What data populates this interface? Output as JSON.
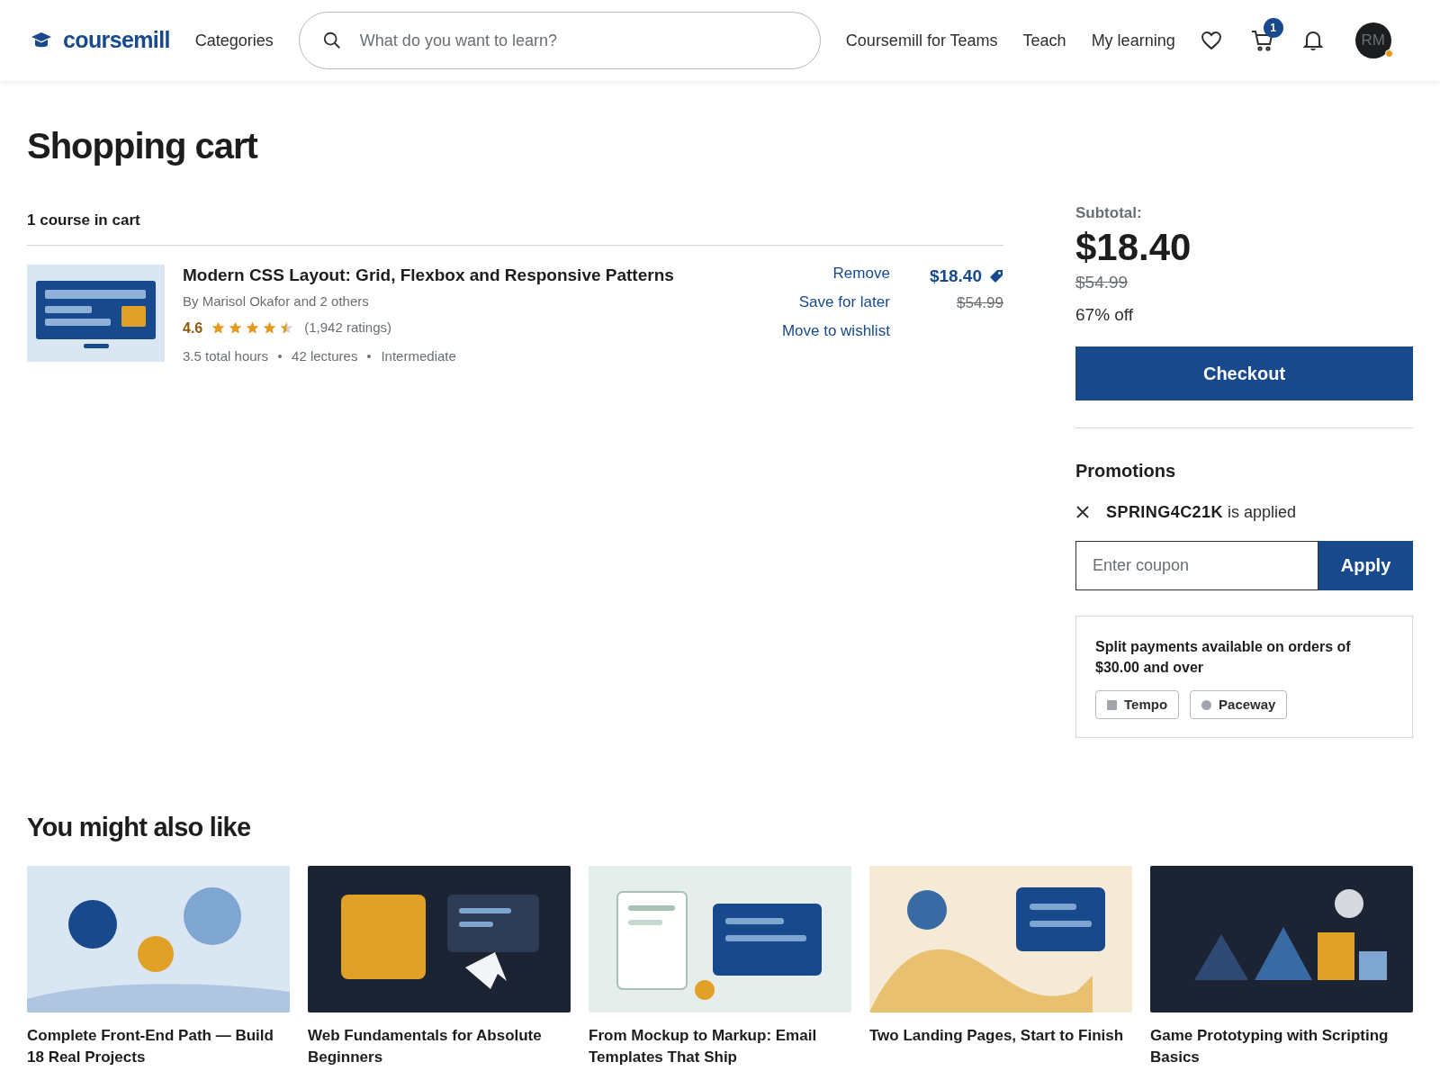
{
  "header": {
    "logo": "coursemill",
    "nav_left": "Categories",
    "search": {
      "placeholder": "What do you want to learn?"
    },
    "nav_right": [
      "Coursemill for Teams",
      "Teach",
      "My learning"
    ],
    "cart_count": "1",
    "avatar": "RM"
  },
  "title": "Shopping cart",
  "cart": {
    "count_label": "1 course in cart",
    "items": [
      {
        "title": "Modern CSS Layout: Grid, Flexbox and Responsive Patterns",
        "author": "By Marisol Okafor and 2 others",
        "rating": "4.6",
        "stars": 4.5,
        "ratings": "(1,942 ratings)",
        "meta": [
          "3.5 total hours",
          "42 lectures",
          "Intermediate"
        ],
        "actions": [
          "Remove",
          "Save for later",
          "Move to wishlist"
        ],
        "price": "$18.40",
        "old_price": "$54.99"
      }
    ]
  },
  "summary": {
    "label": "Subtotal:",
    "total": "$18.40",
    "old_total": "$54.99",
    "discount": "67% off",
    "checkout": "Checkout"
  },
  "promotions": {
    "title": "Promotions",
    "applied_code": "SPRING4C21K",
    "applied_suffix": "is applied",
    "coupon": {
      "placeholder": "Enter coupon"
    },
    "apply": "Apply"
  },
  "split": {
    "text": "Split payments available on orders of $30.00 and over",
    "providers": [
      {
        "name": "Tempo",
        "kind": "square"
      },
      {
        "name": "Paceway",
        "kind": "circle"
      }
    ]
  },
  "recommendations": {
    "title": "You might also like",
    "cards": [
      {
        "title": "Complete Front-End Path — Build 18 Real Projects",
        "kind": "circles"
      },
      {
        "title": "Web Fundamentals for Absolute Beginners",
        "kind": "cursor"
      },
      {
        "title": "From Mockup to Markup: Email Templates That Ship",
        "kind": "mockup"
      },
      {
        "title": "Two Landing Pages, Start to Finish",
        "kind": "landscape"
      },
      {
        "title": "Game Prototyping with Scripting Basics",
        "kind": "shapes"
      }
    ]
  }
}
